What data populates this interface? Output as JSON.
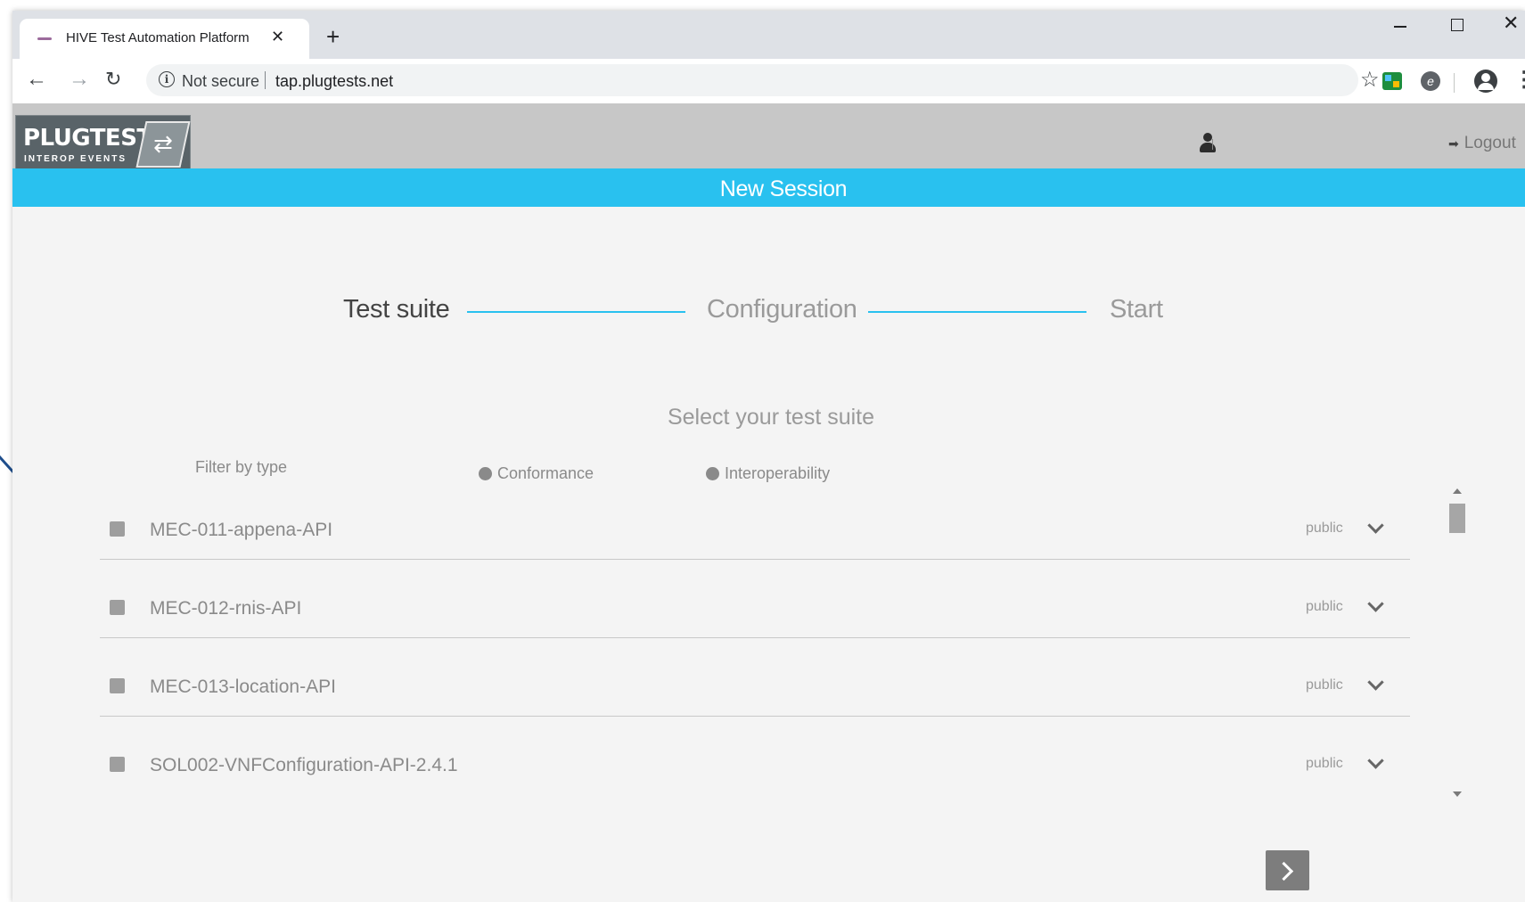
{
  "browser": {
    "tab_title": "HIVE Test Automation Platform",
    "tab_close": "✕",
    "new_tab": "+",
    "security_label": "Not secure",
    "url": "tap.plugtests.net",
    "window_close": "✕"
  },
  "header": {
    "logo_main": "PLUGTESTS",
    "logo_sub": "INTEROP EVENTS",
    "logout_label": "Logout"
  },
  "page": {
    "title": "New Session"
  },
  "stepper": {
    "steps": [
      {
        "label": "Test suite",
        "active": true
      },
      {
        "label": "Configuration",
        "active": false
      },
      {
        "label": "Start",
        "active": false
      }
    ],
    "accent_color": "#29c1ef"
  },
  "selection": {
    "heading": "Select your test suite",
    "filter_label": "Filter by type",
    "filters": [
      {
        "label": "Conformance"
      },
      {
        "label": "Interoperability"
      }
    ]
  },
  "suites": [
    {
      "name": "MEC-011-appena-API",
      "visibility": "public"
    },
    {
      "name": "MEC-012-rnis-API",
      "visibility": "public"
    },
    {
      "name": "MEC-013-location-API",
      "visibility": "public"
    },
    {
      "name": "SOL002-VNFConfiguration-API-2.4.1",
      "visibility": "public"
    }
  ],
  "colors": {
    "header_bg": "#c7c7c7",
    "title_bar": "#29c1ef",
    "page_bg": "#f4f4f4"
  }
}
